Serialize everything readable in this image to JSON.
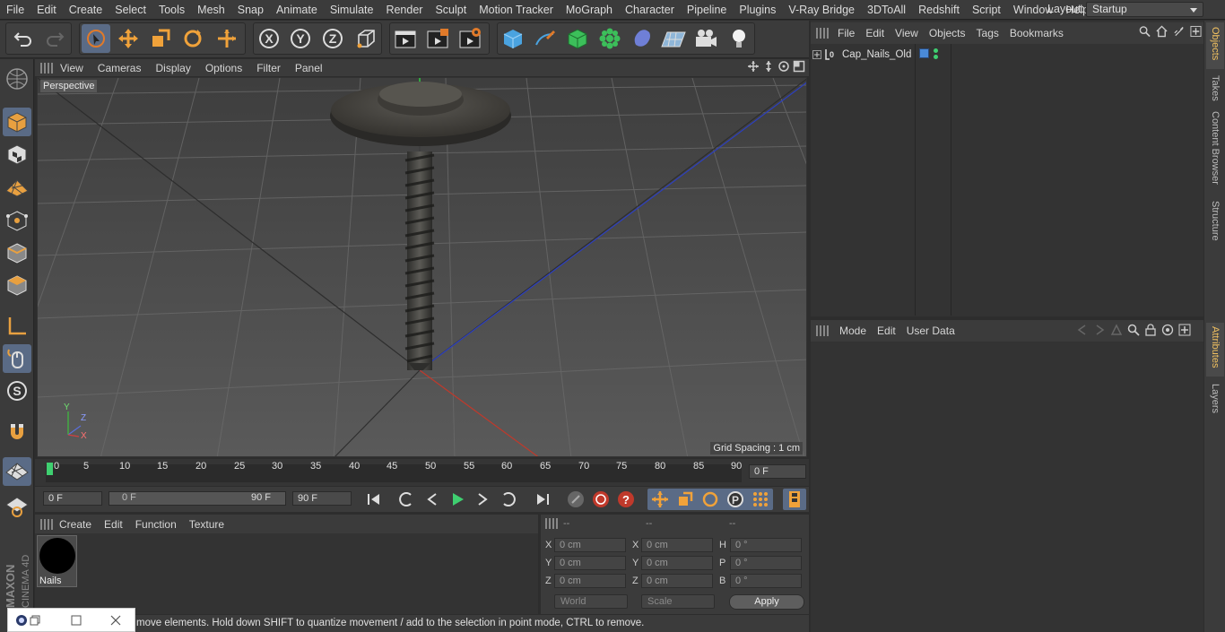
{
  "menubar": {
    "items": [
      "File",
      "Edit",
      "Create",
      "Select",
      "Tools",
      "Mesh",
      "Snap",
      "Animate",
      "Simulate",
      "Render",
      "Sculpt",
      "Motion Tracker",
      "MoGraph",
      "Character",
      "Pipeline",
      "Plugins",
      "V-Ray Bridge",
      "3DToAll",
      "Redshift",
      "Script",
      "Window",
      "Help"
    ],
    "layout_label": "Layout:",
    "layout_value": "Startup"
  },
  "viewport": {
    "menu": [
      "View",
      "Cameras",
      "Display",
      "Options",
      "Filter",
      "Panel"
    ],
    "camera_label": "Perspective",
    "grid_spacing": "Grid Spacing : 1 cm",
    "axis_labels": {
      "y": "Y",
      "z": "Z",
      "x": "X"
    }
  },
  "timeline": {
    "ticks": [
      "0",
      "5",
      "10",
      "15",
      "20",
      "25",
      "30",
      "35",
      "40",
      "45",
      "50",
      "55",
      "60",
      "65",
      "70",
      "75",
      "80",
      "85",
      "90"
    ],
    "current_frame": "0 F"
  },
  "transport": {
    "start_frame": "0 F",
    "range_start": "0 F",
    "range_end": "90 F",
    "end_frame": "90 F"
  },
  "material_panel": {
    "menu": [
      "Create",
      "Edit",
      "Function",
      "Texture"
    ],
    "material_name": "Nails"
  },
  "coords": {
    "headers": [
      "--",
      "--",
      "--"
    ],
    "pos": {
      "x": "0 cm",
      "y": "0 cm",
      "z": "0 cm"
    },
    "size": {
      "x": "0 cm",
      "y": "0 cm",
      "z": "0 cm"
    },
    "rot": {
      "h": "0 °",
      "p": "0 °",
      "b": "0 °"
    },
    "labels": {
      "x": "X",
      "y": "Y",
      "z": "Z",
      "h": "H",
      "p": "P",
      "b": "B"
    },
    "world": "World",
    "scale": "Scale",
    "apply": "Apply"
  },
  "status_text": "move elements. Hold down SHIFT to quantize movement / add to the selection in point mode, CTRL to remove.",
  "objects_panel": {
    "menu": [
      "File",
      "Edit",
      "View",
      "Objects",
      "Tags",
      "Bookmarks"
    ],
    "object_name": "Cap_Nails_Old"
  },
  "attributes_panel": {
    "menu": [
      "Mode",
      "Edit",
      "User Data"
    ]
  },
  "right_tabs": [
    "Objects",
    "Takes",
    "Content Browser",
    "Structure",
    "Attributes",
    "Layers"
  ],
  "brand": "MAXON CINEMA 4D"
}
